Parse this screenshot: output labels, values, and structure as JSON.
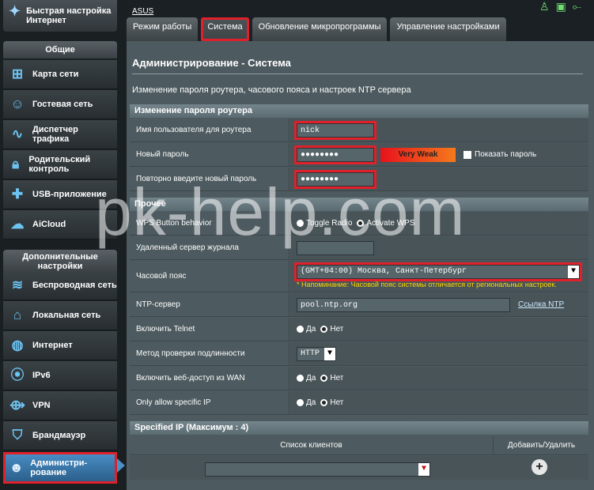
{
  "sidebar": {
    "quick_setup": "Быстрая настройка Интернет",
    "general_header": "Общие",
    "general_items": [
      {
        "label": "Карта сети",
        "icon": "network-map-icon"
      },
      {
        "label": "Гостевая сеть",
        "icon": "guest-network-icon"
      },
      {
        "label": "Диспетчер трафика",
        "icon": "traffic-manager-icon"
      },
      {
        "label": "Родительский контроль",
        "icon": "parental-control-icon"
      },
      {
        "label": "USB-приложение",
        "icon": "usb-app-icon"
      },
      {
        "label": "AiCloud",
        "icon": "aicloud-icon"
      }
    ],
    "advanced_header": "Дополнительные настройки",
    "advanced_items": [
      {
        "label": "Беспроводная сеть",
        "icon": "wireless-icon"
      },
      {
        "label": "Локальная сеть",
        "icon": "lan-icon"
      },
      {
        "label": "Интернет",
        "icon": "wan-globe-icon"
      },
      {
        "label": "IPv6",
        "icon": "ipv6-icon"
      },
      {
        "label": "VPN",
        "icon": "vpn-icon"
      },
      {
        "label": "Брандмауэр",
        "icon": "firewall-icon"
      },
      {
        "label": "Администри- рование",
        "icon": "administration-icon"
      }
    ]
  },
  "topbar": {
    "brand": "ASUS"
  },
  "tabs": [
    "Режим работы",
    "Система",
    "Обновление микропрограммы",
    "Управление настройками"
  ],
  "page": {
    "title": "Администрирование - Система",
    "description": "Изменение пароля роутера, часового пояса и настроек NTP сервера"
  },
  "password_section": {
    "header": "Изменение пароля роутера",
    "username_label": "Имя пользователя для роутера",
    "username_value": "nick",
    "new_password_label": "Новый пароль",
    "new_password_value": "●●●●●●●●",
    "strength": "Very Weak",
    "show_password": "Показать пароль",
    "repeat_label": "Повторно введите новый пароль",
    "repeat_value": "●●●●●●●●"
  },
  "misc_section": {
    "header": "Прочее",
    "wps_label": "WPS Button behavior",
    "wps_opt1": "Toggle Radio",
    "wps_opt2": "Activate WPS",
    "syslog_label": "Удаленный сервер журнала",
    "syslog_value": "",
    "tz_label": "Часовой пояс",
    "tz_value": "(GMT+04:00) Москва, Санкт-Петербург",
    "tz_note": "* Напоминание: Часовой пояс системы отличается от региональных настроек.",
    "ntp_label": "NTP-сервер",
    "ntp_value": "pool.ntp.org",
    "ntp_link": "Ссылка NTP",
    "telnet_label": "Включить Telnet",
    "auth_label": "Метод проверки подлинности",
    "auth_value": "HTTP",
    "wan_label": "Включить веб-доступ из WAN",
    "specific_label": "Only allow specific IP",
    "yes": "Да",
    "no": "Нет"
  },
  "specified_ip": {
    "header": "Specified IP (Максимум : 4)",
    "col_clients": "Список клиентов",
    "col_action": "Добавить/Удалить"
  },
  "watermark": "pk-help.com"
}
